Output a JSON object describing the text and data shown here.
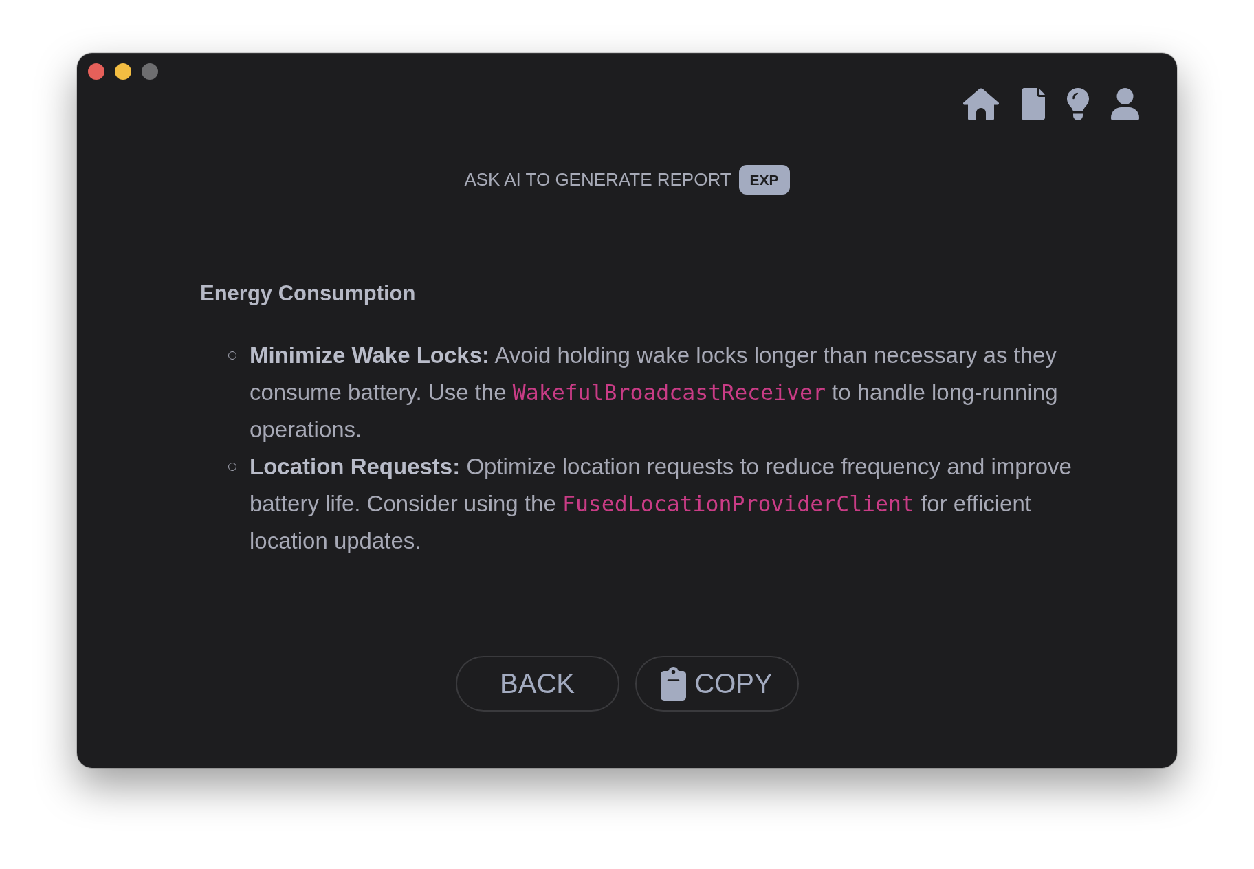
{
  "window_controls": [
    {
      "disabled": false
    },
    {
      "disabled": false
    },
    {
      "disabled": true
    }
  ],
  "header": {
    "title": "ASK AI TO GENERATE REPORT",
    "badge": "EXP"
  },
  "section": {
    "heading": "Energy Consumption",
    "items": [
      {
        "segments": [
          {
            "kind": "bold",
            "text": "Minimize Wake Locks:"
          },
          {
            "kind": "plain",
            "text": "Avoid holding wake locks longer than necessary as they consume battery. Use the"
          },
          {
            "kind": "code",
            "text": "WakefulBroadcastReceiver"
          },
          {
            "kind": "plain",
            "text": "to handle long-running operations."
          }
        ]
      },
      {
        "segments": [
          {
            "kind": "bold",
            "text": "Location Requests:"
          },
          {
            "kind": "plain",
            "text": "Optimize location requests to reduce frequency and improve battery life. Consider using the"
          },
          {
            "kind": "code",
            "text": "FusedLocationProviderClient"
          },
          {
            "kind": "plain",
            "text": "for efficient location updates."
          }
        ]
      }
    ]
  },
  "buttons": [
    {
      "kind": "back",
      "label": "BACK"
    },
    {
      "kind": "copy",
      "label": "COPY"
    }
  ]
}
